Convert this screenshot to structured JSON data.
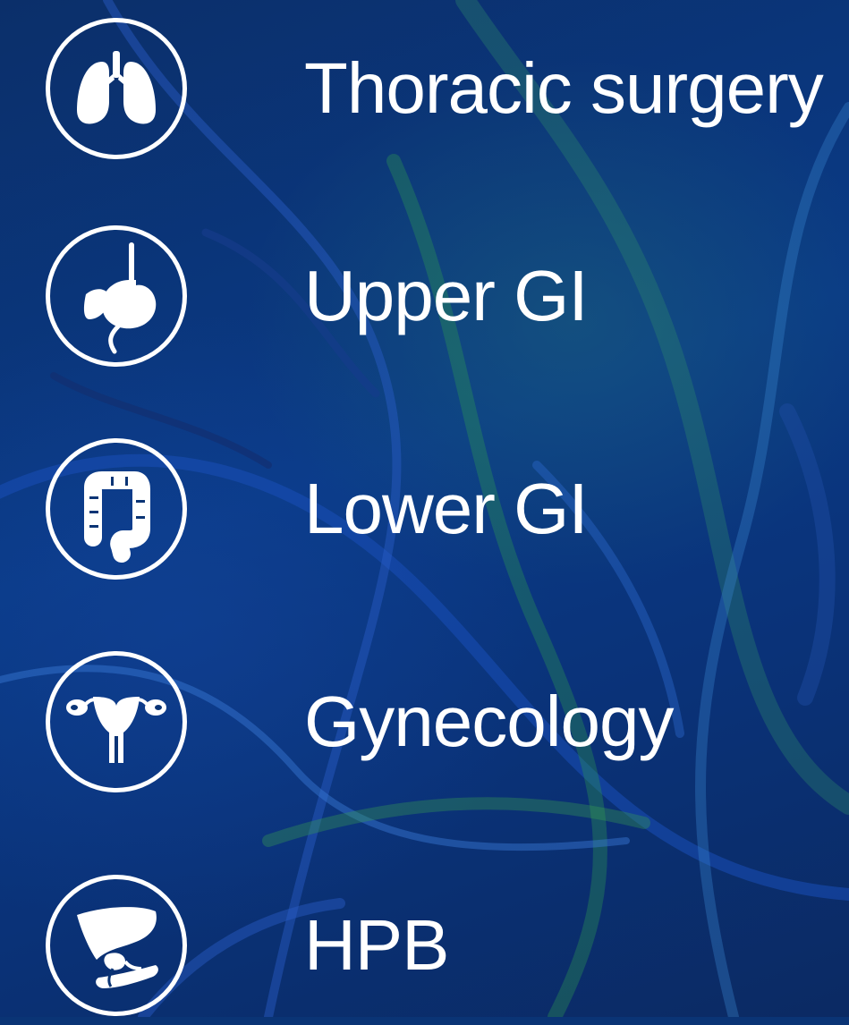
{
  "items": [
    {
      "label": "Thoracic surgery",
      "icon": "lungs-icon"
    },
    {
      "label": "Upper GI",
      "icon": "esophagus-stomach-icon"
    },
    {
      "label": "Lower GI",
      "icon": "colon-icon"
    },
    {
      "label": "Gynecology",
      "icon": "uterus-icon"
    },
    {
      "label": "HPB",
      "icon": "liver-pancreas-icon"
    }
  ],
  "colors": {
    "background": "#0a3475",
    "foreground": "#ffffff"
  }
}
